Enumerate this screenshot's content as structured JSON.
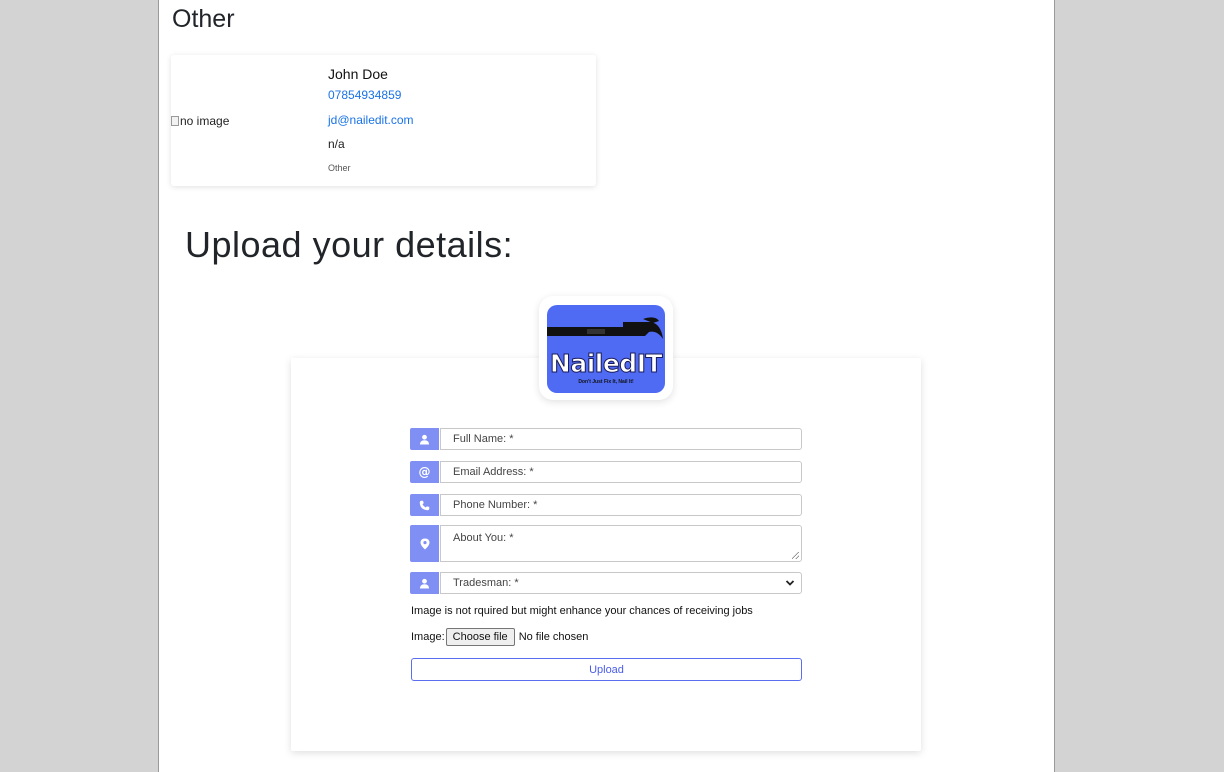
{
  "section": {
    "title": "Other"
  },
  "card": {
    "image_alt": "no image",
    "name": "John Doe",
    "phone": "07854934859",
    "email": "jd@nailedit.com",
    "description": "n/a",
    "category": "Other"
  },
  "upload": {
    "title": "Upload your details:"
  },
  "logo": {
    "brand": "NailedIT",
    "tagline": "Don't Just Fix It, Nail It!"
  },
  "form": {
    "fullname_placeholder": "Full Name: *",
    "email_placeholder": "Email Address: *",
    "phone_placeholder": "Phone Number: *",
    "about_placeholder": "About You: *",
    "trade_selected": "Tradesman: *",
    "image_hint": "Image is not rquired but might enhance your chances of receiving jobs",
    "image_label": "Image:",
    "choose_file_label": "Choose file",
    "no_file_text": "No file chosen",
    "upload_label": "Upload"
  },
  "colors": {
    "accent": "#7f8ff4",
    "logo_bg": "#4f6bf3",
    "link": "#1a73e8",
    "button_border": "#5b6ef0"
  },
  "icons": [
    "user-icon",
    "at-icon",
    "phone-icon",
    "location-pin-icon",
    "tradesman-icon",
    "chevron-down-icon",
    "hammer-icon"
  ]
}
